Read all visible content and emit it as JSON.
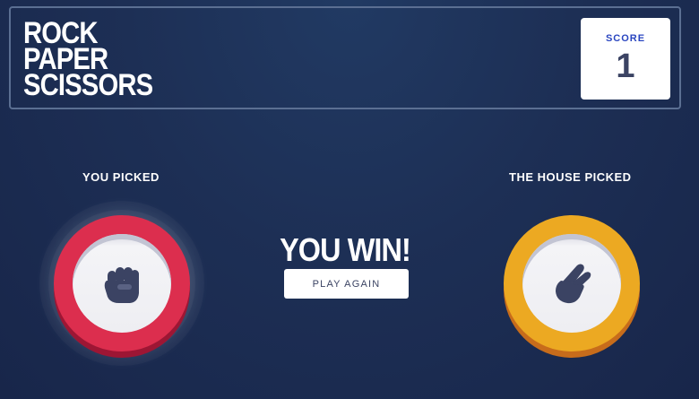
{
  "header": {
    "title_lines": [
      "ROCK",
      "PAPER",
      "SCISSORS"
    ]
  },
  "score": {
    "label": "SCORE",
    "value": "1"
  },
  "player": {
    "label": "YOU PICKED",
    "choice_icon": "rock-fist-icon",
    "ring_color": "#dc2e4e"
  },
  "house": {
    "label": "THE HOUSE PICKED",
    "choice_icon": "scissors-hand-icon",
    "ring_color": "#eca922"
  },
  "result": {
    "text": "YOU WIN!",
    "play_again_label": "PLAY AGAIN"
  },
  "colors": {
    "background": "#1d2f55",
    "header_border": "#5b6f92",
    "score_label": "#2a46c0",
    "dark_text": "#3b4363"
  }
}
